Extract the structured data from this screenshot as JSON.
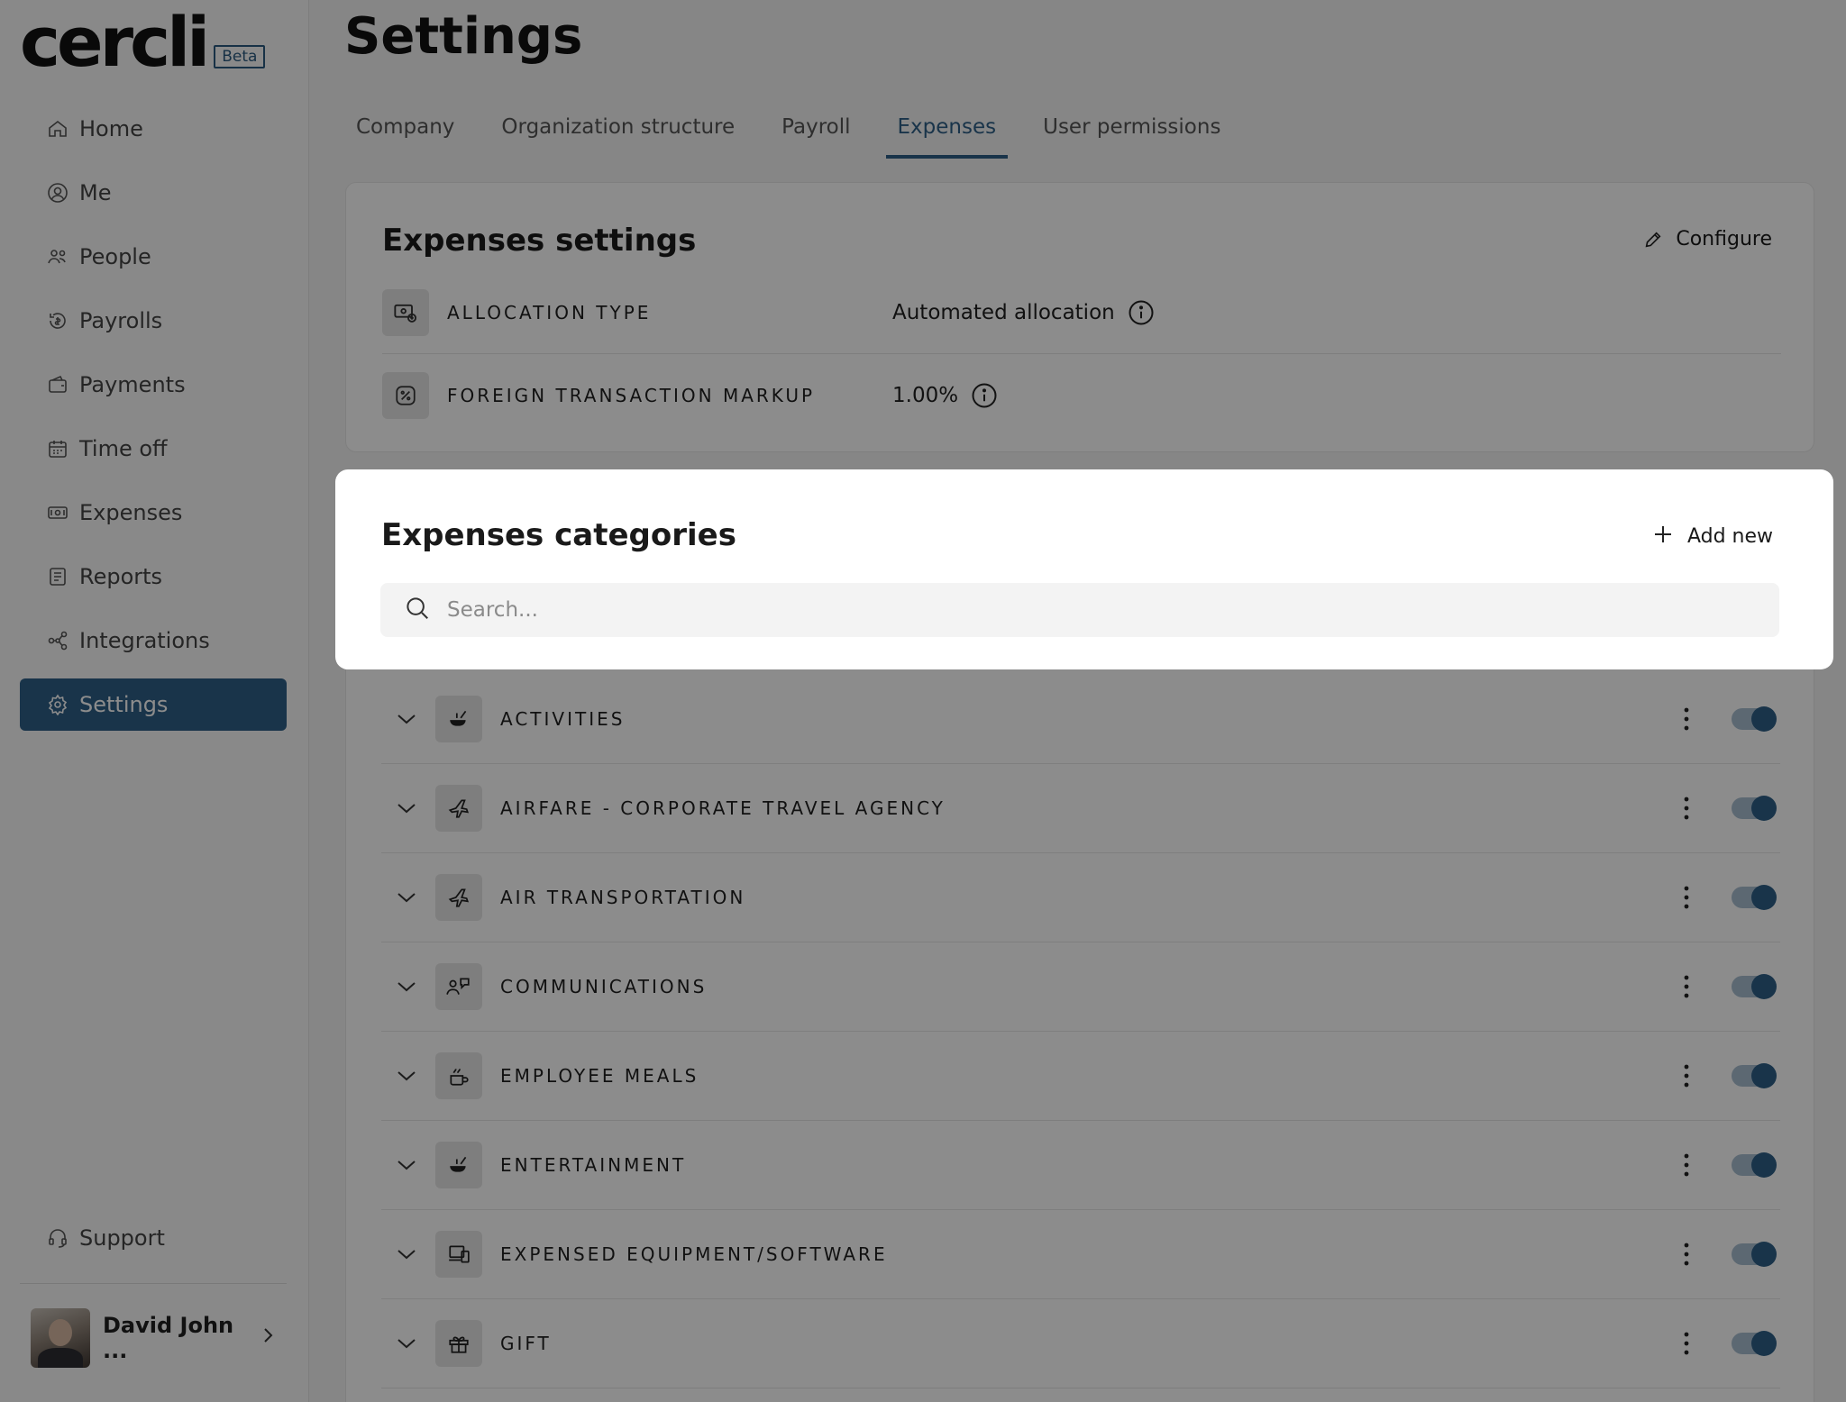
{
  "brand": {
    "logo_text": "cercli",
    "badge": "Beta"
  },
  "sidebar": {
    "items": [
      {
        "label": "Home",
        "icon": "home-icon",
        "active": false
      },
      {
        "label": "Me",
        "icon": "user-circle-icon",
        "active": false
      },
      {
        "label": "People",
        "icon": "people-icon",
        "active": false
      },
      {
        "label": "Payrolls",
        "icon": "payroll-icon",
        "active": false
      },
      {
        "label": "Payments",
        "icon": "wallet-icon",
        "active": false
      },
      {
        "label": "Time off",
        "icon": "calendar-icon",
        "active": false
      },
      {
        "label": "Expenses",
        "icon": "money-icon",
        "active": false
      },
      {
        "label": "Reports",
        "icon": "report-icon",
        "active": false
      },
      {
        "label": "Integrations",
        "icon": "integrations-icon",
        "active": false
      },
      {
        "label": "Settings",
        "icon": "gear-icon",
        "active": true
      }
    ],
    "support": "Support",
    "user_name": "David John ..."
  },
  "page": {
    "title": "Settings",
    "tabs": [
      "Company",
      "Organization structure",
      "Payroll",
      "Expenses",
      "User permissions"
    ],
    "active_tab": "Expenses"
  },
  "expenses_settings": {
    "title": "Expenses settings",
    "configure_label": "Configure",
    "rows": [
      {
        "label": "ALLOCATION TYPE",
        "value": "Automated allocation"
      },
      {
        "label": "FOREIGN TRANSACTION MARKUP",
        "value": "1.00%"
      }
    ]
  },
  "categories": {
    "title": "Expenses categories",
    "add_label": "Add new",
    "search_placeholder": "Search...",
    "items": [
      {
        "label": "ACTIVITIES",
        "icon": "activities-icon",
        "enabled": true
      },
      {
        "label": "AIRFARE - CORPORATE TRAVEL AGENCY",
        "icon": "plane-icon",
        "enabled": true
      },
      {
        "label": "AIR TRANSPORTATION",
        "icon": "plane-icon",
        "enabled": true
      },
      {
        "label": "COMMUNICATIONS",
        "icon": "communications-icon",
        "enabled": true
      },
      {
        "label": "EMPLOYEE MEALS",
        "icon": "meal-icon",
        "enabled": true
      },
      {
        "label": "ENTERTAINMENT",
        "icon": "activities-icon",
        "enabled": true
      },
      {
        "label": "EXPENSED EQUIPMENT/SOFTWARE",
        "icon": "device-icon",
        "enabled": true
      },
      {
        "label": "GIFT",
        "icon": "gift-icon",
        "enabled": true
      }
    ]
  },
  "colors": {
    "accent": "#2e5f87",
    "overlay": "rgba(0,0,0,0.45)"
  }
}
